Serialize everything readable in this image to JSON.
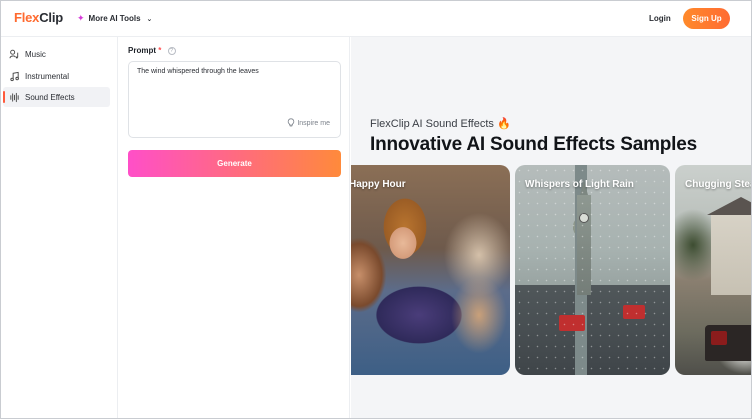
{
  "header": {
    "logo_flex": "Flex",
    "logo_clip": "Clip",
    "ai_tools_label": "More AI Tools",
    "login_label": "Login",
    "signup_label": "Sign Up"
  },
  "sidebar": {
    "items": [
      {
        "label": "Music",
        "icon": "music-note-user-icon",
        "active": false
      },
      {
        "label": "Instrumental",
        "icon": "music-note-icon",
        "active": false
      },
      {
        "label": "Sound Effects",
        "icon": "sound-wave-icon",
        "active": true
      }
    ]
  },
  "form": {
    "prompt_label": "Prompt",
    "required_mark": "*",
    "help_mark": "?",
    "prompt_value": "The wind whispered through the leaves",
    "inspire_label": "Inspire me",
    "generate_label": "Generate"
  },
  "content": {
    "subtitle": "FlexClip AI Sound Effects 🔥",
    "title": "Innovative AI Sound Effects Samples",
    "cards": [
      {
        "label": "Happy Hour"
      },
      {
        "label": "Whispers of Light Rain"
      },
      {
        "label": "Chugging Steam"
      }
    ]
  },
  "colors": {
    "brand_orange": "#ff6a2f",
    "signup_bg": "#ff7a30",
    "generate_start": "#ff4fc8",
    "generate_end": "#ff8a3b",
    "active_indicator": "#ff5a3c"
  }
}
